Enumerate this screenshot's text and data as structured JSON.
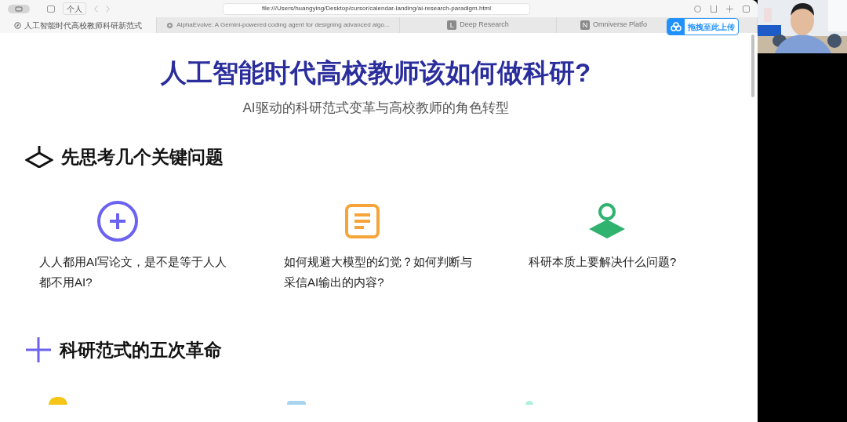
{
  "toolbar": {
    "profile": "个人",
    "address": "file:///Users/huangying/Desktop/cursor/calendar-landing/ai-research-paradigm.html"
  },
  "tabs": [
    {
      "label": "人工智能时代高校教师科研新范式",
      "selected": true,
      "kind": "compass"
    },
    {
      "label": "AlphaEvolve: A Gemini-powered coding agent for designing advanced algo...",
      "selected": false,
      "kind": "gear"
    },
    {
      "label": "Deep Research",
      "selected": false,
      "kind": "letter",
      "badge": "L"
    },
    {
      "label": "Omniverse Platfo",
      "selected": false,
      "kind": "letter",
      "badge": "N"
    }
  ],
  "upload_badge": {
    "label": "拖拽至此上传"
  },
  "page": {
    "title": "人工智能时代高校教师该如何做科研?",
    "subtitle": "AI驱动的科研范式变革与高校教师的角色转型",
    "sections": [
      {
        "heading": "先思考几个关键问题",
        "kind": "diamond",
        "cards": [
          {
            "kind": "plus-circle",
            "color": "#6b63f0",
            "text": "人人都用AI写论文，是不是等于人人都不用AI?"
          },
          {
            "kind": "document",
            "color": "#f5a43a",
            "text": "如何规避大模型的幻觉？如何判断与采信AI输出的内容?"
          },
          {
            "kind": "person",
            "color": "#2fb36f",
            "text": "科研本质上要解决什么问题?"
          }
        ]
      },
      {
        "heading": "科研范式的五次革命",
        "kind": "plus"
      }
    ]
  }
}
